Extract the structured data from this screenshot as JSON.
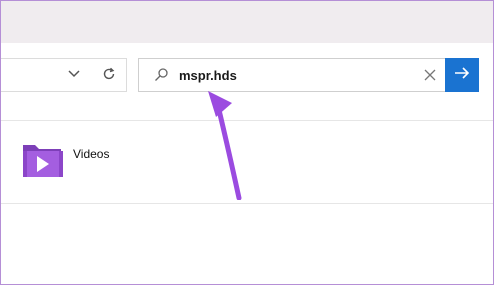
{
  "search": {
    "value": "mspr.hds",
    "placeholder": ""
  },
  "items": [
    {
      "label": "Videos",
      "icon": "video-folder-icon"
    }
  ],
  "colors": {
    "accent": "#1a73d1",
    "annotation": "#9b4be0",
    "frame": "#b58fd6"
  }
}
